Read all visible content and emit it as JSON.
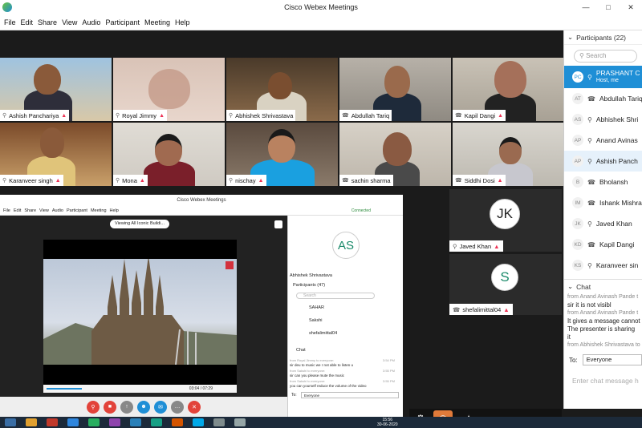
{
  "window": {
    "title": "Cisco Webex Meetings"
  },
  "menu": [
    "File",
    "Edit",
    "Share",
    "View",
    "Audio",
    "Participant",
    "Meeting",
    "Help"
  ],
  "video_tiles": [
    {
      "name": "Ashish Panchariya"
    },
    {
      "name": "Royal Jimmy"
    },
    {
      "name": "Abhishek Shrivastava"
    },
    {
      "name": "Abdullah Tariq"
    },
    {
      "name": "Kapil Dangi"
    },
    {
      "name": "Karanveer singh"
    },
    {
      "name": "Mona"
    },
    {
      "name": "nischay"
    },
    {
      "name": "sachin sharma"
    },
    {
      "name": "Siddhi Dosi"
    }
  ],
  "avatar_tiles": [
    {
      "initials": "JK",
      "name": "Javed Khan"
    },
    {
      "initials": "S",
      "name": "shefalimittal04"
    }
  ],
  "shared_screen": {
    "title": "Cisco Webex Meetings",
    "menu": [
      "File",
      "Edit",
      "Share",
      "View",
      "Audio",
      "Participant",
      "Meeting",
      "Help"
    ],
    "status": "Connected",
    "viewing": "Viewing All Iconic Buildi...",
    "time": "03:04 / 07:29",
    "presenter_initials": "AS",
    "presenter_name": "Abhishek Shrivastava",
    "participants_head": "Participants (47)",
    "search_placeholder": "Search",
    "participants": [
      "SAHAR",
      "Sakshi",
      "shefalimittal04"
    ],
    "chat_head": "Chat",
    "chat": [
      {
        "meta": "from Royal Jimmy to everyone:",
        "text": "sir deu to music we r not able to listen u",
        "time": "3:54 PM"
      },
      {
        "meta": "from Sakshi to everyone:",
        "text": "sir can you please mute the music",
        "time": "3:55 PM"
      },
      {
        "meta": "from Sakshi to everyone:",
        "text": "you can yourself reduce the volume of the video",
        "time": "3:55 PM"
      }
    ],
    "to_label": "To:",
    "to_value": "Everyone"
  },
  "participants_panel": {
    "title": "Participants (22)",
    "search_placeholder": "Search",
    "host": {
      "initials": "PC",
      "name": "PRASHANT C",
      "role": "Host, me"
    },
    "list": [
      {
        "initials": "AT",
        "name": "Abdullah Tariq"
      },
      {
        "initials": "AS",
        "name": "Abhishek Shri"
      },
      {
        "initials": "AP",
        "name": "Anand Avinas"
      },
      {
        "initials": "AP",
        "name": "Ashish Panch"
      },
      {
        "initials": "B",
        "name": "Bholansh"
      },
      {
        "initials": "IM",
        "name": "Ishank Mishra"
      },
      {
        "initials": "JK",
        "name": "Javed Khan"
      },
      {
        "initials": "KD",
        "name": "Kapil Dangi"
      },
      {
        "initials": "KS",
        "name": "Karanveer sin"
      }
    ]
  },
  "chat": {
    "title": "Chat",
    "messages": [
      {
        "meta": "from Anand Avinash Pande t",
        "text": "sir it is not visibl"
      },
      {
        "meta": "from Anand Avinash Pande t",
        "text": "It gives a message cannot"
      },
      {
        "meta": "",
        "text": "The presenter is sharing"
      },
      {
        "meta": "",
        "text": "it"
      },
      {
        "meta": "from Abhishek Shrivastava to",
        "text": ""
      }
    ],
    "to_label": "To:",
    "to_value": "Everyone",
    "input_placeholder": "Enter chat message h"
  },
  "taskbar": {
    "clock_time": "15:56",
    "clock_date": "30-06-2020"
  }
}
